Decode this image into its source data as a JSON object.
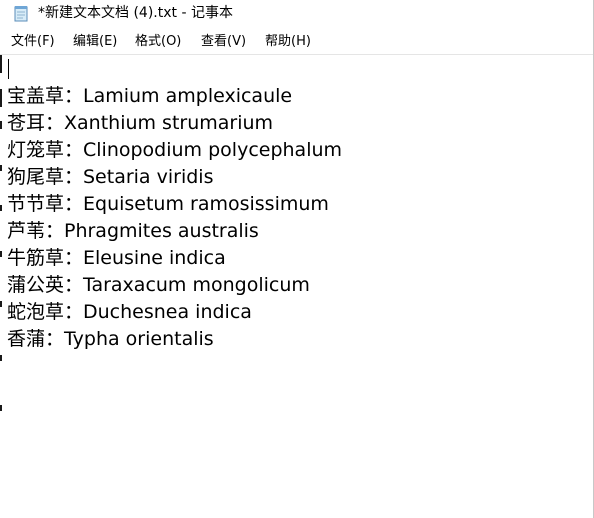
{
  "title": "*新建文本文档 (4).txt - 记事本",
  "icons": {
    "app": "notepad-icon"
  },
  "menu": {
    "file": "文件(F)",
    "edit": "编辑(E)",
    "format": "格式(O)",
    "view": "查看(V)",
    "help": "帮助(H)"
  },
  "lines": [
    "宝盖草：Lamium amplexicaule",
    "苍耳：Xanthium strumarium",
    "灯笼草：Clinopodium polycephalum",
    "狗尾草：Setaria viridis",
    "节节草：Equisetum ramosissimum",
    "芦苇：Phragmites australis",
    "牛筋草：Eleusine indica",
    "蒲公英：Taraxacum mongolicum",
    "蛇泡草：Duchesnea indica",
    "香蒲：Typha orientalis"
  ]
}
